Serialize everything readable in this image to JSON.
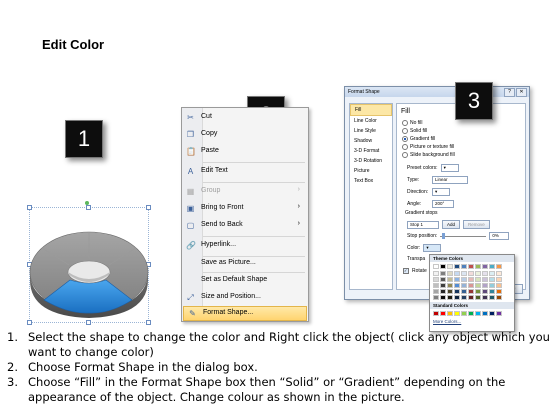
{
  "title": "Edit Color",
  "steps_badges": [
    "1",
    "2",
    "3"
  ],
  "context_menu": {
    "items": [
      {
        "label": "Cut",
        "icon": "scissors-icon",
        "glyph": "✂",
        "disabled": false,
        "submenu": false
      },
      {
        "label": "Copy",
        "icon": "copy-icon",
        "glyph": "❐",
        "disabled": false,
        "submenu": false
      },
      {
        "label": "Paste",
        "icon": "paste-icon",
        "glyph": "📋",
        "disabled": false,
        "submenu": false
      },
      {
        "label": "Edit Text",
        "icon": "edit-text-icon",
        "glyph": "A",
        "disabled": false,
        "submenu": false
      },
      {
        "label": "Group",
        "icon": "group-icon",
        "glyph": "▦",
        "disabled": true,
        "submenu": true
      },
      {
        "label": "Bring to Front",
        "icon": "bring-front-icon",
        "glyph": "▣",
        "disabled": false,
        "submenu": true
      },
      {
        "label": "Send to Back",
        "icon": "send-back-icon",
        "glyph": "▢",
        "disabled": false,
        "submenu": true
      },
      {
        "label": "Hyperlink...",
        "icon": "hyperlink-icon",
        "glyph": "🔗",
        "disabled": false,
        "submenu": false
      },
      {
        "label": "Save as Picture...",
        "icon": "",
        "glyph": "",
        "disabled": false,
        "submenu": false
      },
      {
        "label": "Set as Default Shape",
        "icon": "",
        "glyph": "",
        "disabled": false,
        "submenu": false
      },
      {
        "label": "Size and Position...",
        "icon": "size-position-icon",
        "glyph": "⤢",
        "disabled": false,
        "submenu": false
      },
      {
        "label": "Format Shape...",
        "icon": "format-shape-icon",
        "glyph": "✎",
        "disabled": false,
        "submenu": false,
        "highlighted": true
      }
    ]
  },
  "format_dialog": {
    "title": "Format Shape",
    "sidebar": [
      "Fill",
      "Line Color",
      "Line Style",
      "Shadow",
      "3-D Format",
      "3-D Rotation",
      "Picture",
      "Text Box"
    ],
    "fill_heading": "Fill",
    "fill_options": [
      {
        "label": "No fill",
        "selected": false
      },
      {
        "label": "Solid fill",
        "selected": false
      },
      {
        "label": "Gradient fill",
        "selected": true
      },
      {
        "label": "Picture or texture fill",
        "selected": false
      },
      {
        "label": "Slide background fill",
        "selected": false
      }
    ],
    "preset_label": "Preset colors:",
    "type_label": "Type:",
    "type_value": "Linear",
    "direction_label": "Direction:",
    "angle_label": "Angle:",
    "angle_value": "200°",
    "gradient_stops_label": "Gradient stops",
    "stop_value": "Stop 1",
    "add_label": "Add",
    "remove_label": "Remove",
    "stop_position_label": "Stop position:",
    "stop_position_value": "0%",
    "color_label": "Color:",
    "transparency_label": "Transpa",
    "rotate_label": "Rotate",
    "close_label": "Close"
  },
  "palette": {
    "theme_heading": "Theme Colors",
    "standard_heading": "Standard Colors",
    "more_colors": "More Colors...",
    "theme_top": [
      "#ffffff",
      "#000000",
      "#eeece1",
      "#1f497d",
      "#4f81bd",
      "#c0504d",
      "#9bbb59",
      "#8064a2",
      "#4bacc6",
      "#f79646"
    ],
    "theme_shades": [
      [
        "#f2f2f2",
        "#7f7f7f",
        "#ddd9c3",
        "#c6d9f0",
        "#dbe5f1",
        "#f2dcdb",
        "#ebf1dd",
        "#e5e0ec",
        "#dbeef3",
        "#fdeada"
      ],
      [
        "#d8d8d8",
        "#595959",
        "#c4bd97",
        "#8db3e2",
        "#b8cce4",
        "#e5b9b7",
        "#d7e3bc",
        "#ccc1d9",
        "#b7dde8",
        "#fbd5b5"
      ],
      [
        "#bfbfbf",
        "#3f3f3f",
        "#938953",
        "#548dd4",
        "#95b3d7",
        "#d99694",
        "#c3d69b",
        "#b2a2c7",
        "#92cddc",
        "#fac08f"
      ],
      [
        "#a5a5a5",
        "#262626",
        "#494429",
        "#17365d",
        "#366092",
        "#953734",
        "#76923c",
        "#5f497a",
        "#31859b",
        "#e36c09"
      ],
      [
        "#7f7f7f",
        "#0c0c0c",
        "#1d1b10",
        "#0f243e",
        "#244061",
        "#632423",
        "#4f6128",
        "#3f3151",
        "#205867",
        "#974806"
      ]
    ],
    "standard": [
      "#c00000",
      "#ff0000",
      "#ffc000",
      "#ffff00",
      "#92d050",
      "#00b050",
      "#00b0f0",
      "#0070c0",
      "#002060",
      "#7030a0"
    ]
  },
  "instructions": [
    {
      "num": "1.",
      "text": "Select the shape to change the color and Right click the object( click any object which you want to change color)"
    },
    {
      "num": "2.",
      "text": "Choose Format Shape in the dialog box."
    },
    {
      "num": "3.",
      "text": "Choose “Fill” in the Format Shape box then “Solid” or “Gradient” depending on the appearance of the object. Change colour as shown in the picture."
    }
  ],
  "colors": {
    "accent_blue": "#1e7fd0",
    "ring_gray": "#8c8c8c",
    "badge": "#0d0d0d"
  }
}
